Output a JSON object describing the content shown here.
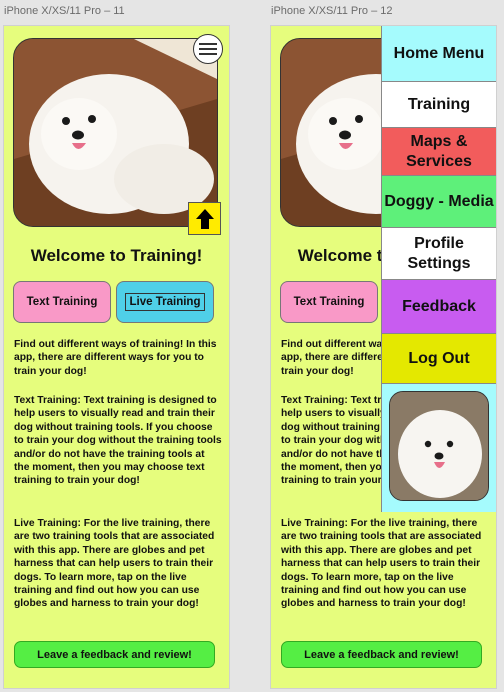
{
  "frames": [
    {
      "label": "iPhone X/XS/11 Pro – 11",
      "title": "Welcome to Training!",
      "text_training_label": "Text Training",
      "live_training_label": "Live Training",
      "intro": "Find out different ways of training! In this app, there are different ways for you to train your dog!",
      "text_desc": "Text Training: Text training is designed to help users to visually read and train their dog without training tools. If you choose to train your dog without the training tools and/or do not have the training tools at the moment, then you may choose text training to train your dog!",
      "live_desc": "Live Training: For the live training, there are two training tools that are associated with this app. There are globes and pet harness that can help users to train their dogs. To learn more, tap on the live training and find out how you can use globes and harness to train your dog!",
      "feedback_label": "Leave a feedback and review!"
    },
    {
      "label": "iPhone X/XS/11 Pro – 12",
      "title": "Welcome to Training!",
      "text_training_label": "Text Training",
      "intro": "Find out different ways of training! In this app, there are different ways for you to train your dog!",
      "text_desc": "Text Training: Text training is designed to help users to visually read and train their dog without training tools. If you choose to train your dog without the training tools and/or do not have the training tools at the moment, then you may choose text training to train your dog!",
      "live_desc": "Live Training: For the live training, there are two training tools that are associated with this app. There are globes and pet harness that can help users to train their dogs. To learn more, tap on the live training and find out how you can use globes and harness to train your dog!",
      "feedback_label": "Leave a feedback and review!",
      "side_menu": [
        {
          "label": "Home Menu",
          "color": "#a5fbfd"
        },
        {
          "label": "Training",
          "color": "#ffffff"
        },
        {
          "label": "Maps & Services",
          "color": "#f25c5c"
        },
        {
          "label": "Doggy - Media",
          "color": "#5ef07a"
        },
        {
          "label": "Profile Settings",
          "color": "#ffffff"
        },
        {
          "label": "Feedback",
          "color": "#c85cf0"
        },
        {
          "label": "Log Out",
          "color": "#e4e800"
        }
      ]
    }
  ],
  "icons": {
    "menu": "hamburger-icon",
    "up": "arrow-up-icon"
  },
  "colors": {
    "background": "#e6fd7d",
    "text_pill": "#f999c7",
    "live_pill": "#4fd0e8",
    "feedback": "#55ee44"
  }
}
